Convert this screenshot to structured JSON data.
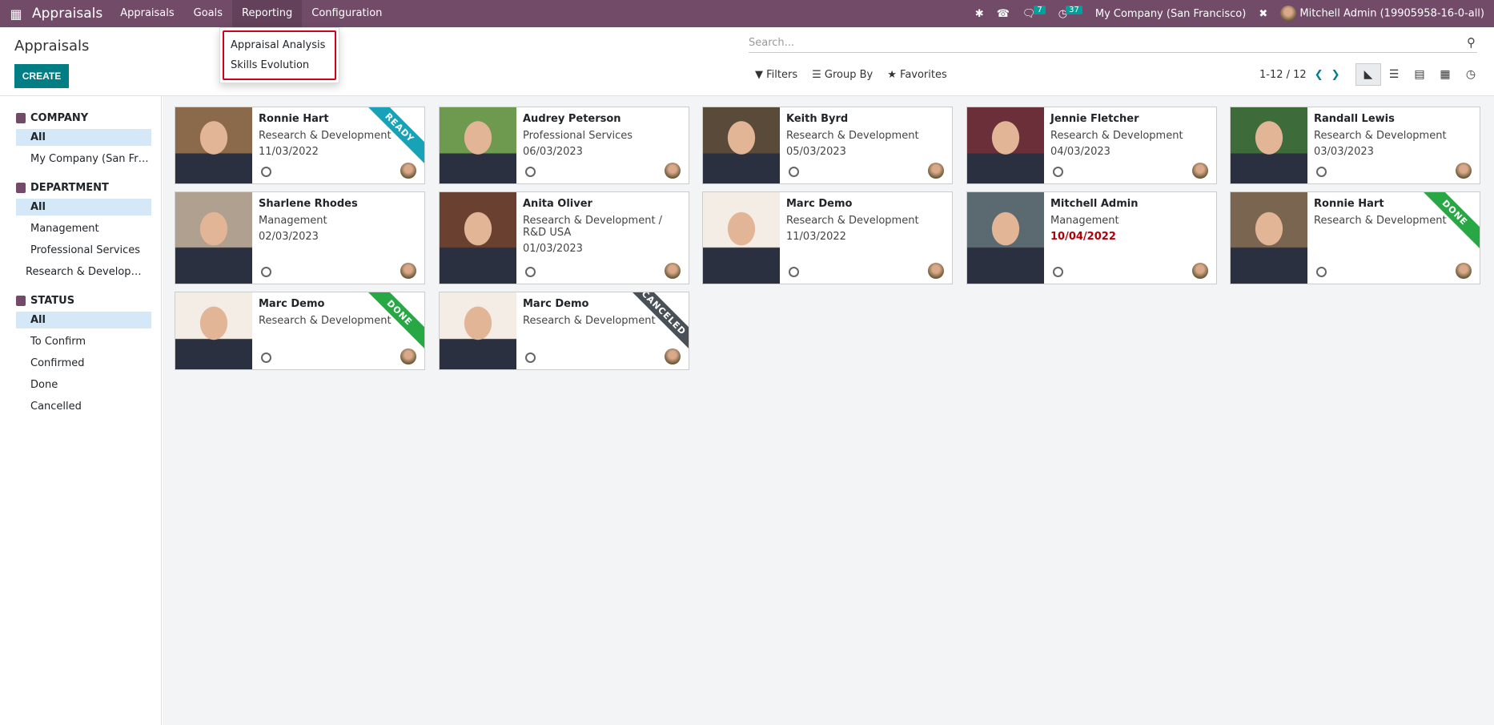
{
  "navbar": {
    "app_title": "Appraisals",
    "menu": [
      "Appraisals",
      "Goals",
      "Reporting",
      "Configuration"
    ],
    "chat_count": "7",
    "activity_count": "37",
    "company": "My Company (San Francisco)",
    "user": "Mitchell Admin (19905958-16-0-all)"
  },
  "reporting_menu": [
    "Appraisal Analysis",
    "Skills Evolution"
  ],
  "control": {
    "title": "Appraisals",
    "create": "CREATE",
    "search_placeholder": "Search...",
    "filters": "Filters",
    "group_by": "Group By",
    "favorites": "Favorites",
    "pager": "1-12 / 12"
  },
  "sidebar": [
    {
      "title": "COMPANY",
      "items": [
        "All",
        "My Company (San Francisco)"
      ]
    },
    {
      "title": "DEPARTMENT",
      "items": [
        "All",
        "Management",
        "Professional Services",
        "Research & Development"
      ]
    },
    {
      "title": "STATUS",
      "items": [
        "All",
        "To Confirm",
        "Confirmed",
        "Done",
        "Cancelled"
      ]
    }
  ],
  "cards": [
    {
      "name": "Ronnie Hart",
      "lines": [
        "Research & Development",
        "11/03/2022"
      ],
      "ribbon": "READY",
      "ribbon_color": "#17a2b8"
    },
    {
      "name": "Audrey Peterson",
      "lines": [
        "Professional Services",
        "06/03/2023"
      ]
    },
    {
      "name": "Keith Byrd",
      "lines": [
        "Research & Development",
        "05/03/2023"
      ]
    },
    {
      "name": "Jennie Fletcher",
      "lines": [
        "Research & Development",
        "04/03/2023"
      ]
    },
    {
      "name": "Randall Lewis",
      "lines": [
        "Research & Development",
        "03/03/2023"
      ]
    },
    {
      "name": "Sharlene Rhodes",
      "lines": [
        "Management",
        "02/03/2023"
      ]
    },
    {
      "name": "Anita Oliver",
      "lines": [
        "Research & Development / R&D USA",
        "01/03/2023"
      ]
    },
    {
      "name": "Marc Demo",
      "lines": [
        "Research & Development",
        "11/03/2022"
      ]
    },
    {
      "name": "Mitchell Admin",
      "lines": [
        "Management",
        "10/04/2022"
      ],
      "late": true
    },
    {
      "name": "Ronnie Hart",
      "lines": [
        "Research & Development"
      ],
      "ribbon": "DONE",
      "ribbon_color": "#28a745"
    },
    {
      "name": "Marc Demo",
      "lines": [
        "Research & Development"
      ],
      "ribbon": "DONE",
      "ribbon_color": "#28a745"
    },
    {
      "name": "Marc Demo",
      "lines": [
        "Research & Development"
      ],
      "ribbon": "CANCELED",
      "ribbon_color": "#495057"
    }
  ]
}
